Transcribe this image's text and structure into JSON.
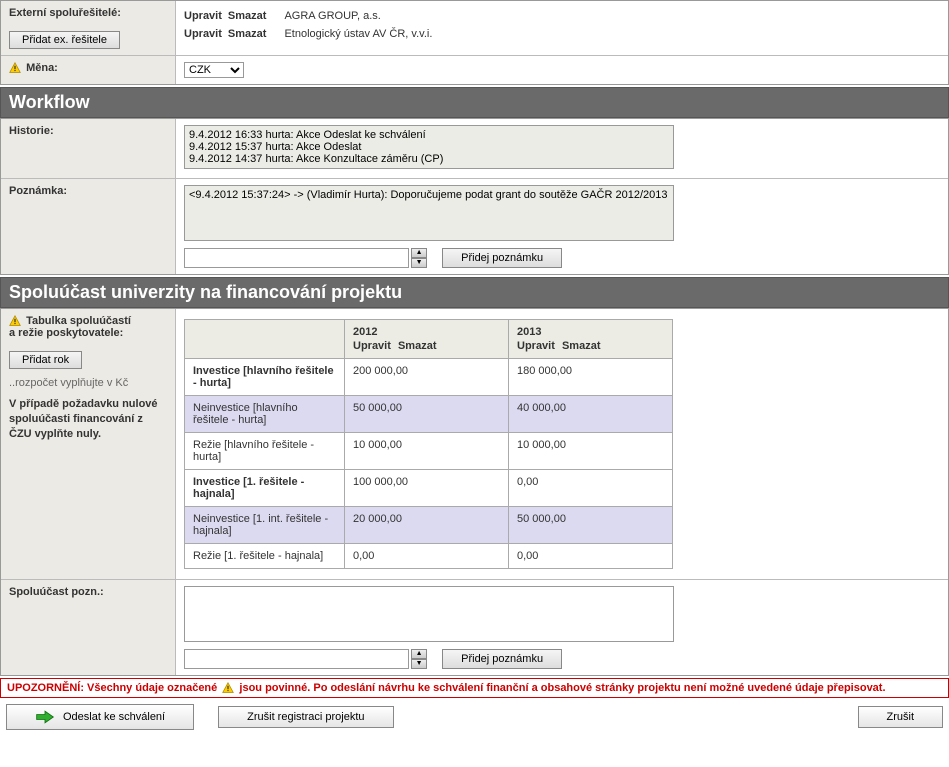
{
  "solvers": {
    "header_label": "Externí spoluřešitelé:",
    "add_button": "Přidat ex. řešitele",
    "edit_label": "Upravit",
    "delete_label": "Smazat",
    "items": [
      {
        "name": "AGRA GROUP, a.s."
      },
      {
        "name": "Etnologický ústav AV ČR, v.v.i."
      }
    ]
  },
  "currency": {
    "label": "Měna:",
    "value": "CZK"
  },
  "workflow": {
    "header": "Workflow",
    "history_label": "Historie:",
    "history_lines": "9.4.2012 16:33 hurta: Akce Odeslat ke schválení\n9.4.2012 15:37 hurta: Akce Odeslat\n9.4.2012 14:37 hurta: Akce Konzultace záměru (CP)",
    "note_label": "Poznámka:",
    "note_text": "<9.4.2012 15:37:24> -> (Vladimír Hurta): Doporučujeme podat grant do soutěže GAČR 2012/2013",
    "add_note_button": "Přidej poznámku"
  },
  "financing": {
    "header": "Spoluúčast univerzity na financování projektu",
    "table_label_line1": "Tabulka spoluúčastí",
    "table_label_line2": "a režie poskytovatele:",
    "add_year_button": "Přidat rok",
    "hint": "..rozpočet vyplňujte v Kč",
    "zero_hint": "V případě požadavku nulové spoluúčasti financování z ČZU vyplňte nuly.",
    "years": [
      {
        "label": "2012",
        "edit": "Upravit",
        "del": "Smazat"
      },
      {
        "label": "2013",
        "edit": "Upravit",
        "del": "Smazat"
      }
    ],
    "rows": [
      {
        "kind": "invest",
        "label": "Investice [hlavního řešitele - hurta]",
        "vals": [
          "200 000,00",
          "180 000,00"
        ]
      },
      {
        "kind": "noninvest",
        "label": "Neinvestice [hlavního řešitele - hurta]",
        "vals": [
          "50 000,00",
          "40 000,00"
        ]
      },
      {
        "kind": "regie",
        "label": "Režie [hlavního řešitele - hurta]",
        "vals": [
          "10 000,00",
          "10 000,00"
        ]
      },
      {
        "kind": "invest",
        "label": "Investice [1. řešitele - hajnala]",
        "vals": [
          "100 000,00",
          "0,00"
        ]
      },
      {
        "kind": "noninvest",
        "label": "Neinvestice [1. int. řešitele - hajnala]",
        "vals": [
          "20 000,00",
          "50 000,00"
        ]
      },
      {
        "kind": "regie",
        "label": "Režie [1. řešitele - hajnala]",
        "vals": [
          "0,00",
          "0,00"
        ]
      }
    ],
    "note_label": "Spoluúčast pozn.:",
    "add_note_button": "Přidej poznámku"
  },
  "warning": {
    "part1": "UPOZORNĚNÍ: Všechny údaje označené ",
    "part2": " jsou povinné. Po odeslání návrhu ke schválení finanční a obsahové stránky projektu není možné uvedené údaje přepisovat."
  },
  "actions": {
    "send": "Odeslat ke schválení",
    "cancel_registration": "Zrušit registraci projektu",
    "cancel": "Zrušit"
  }
}
